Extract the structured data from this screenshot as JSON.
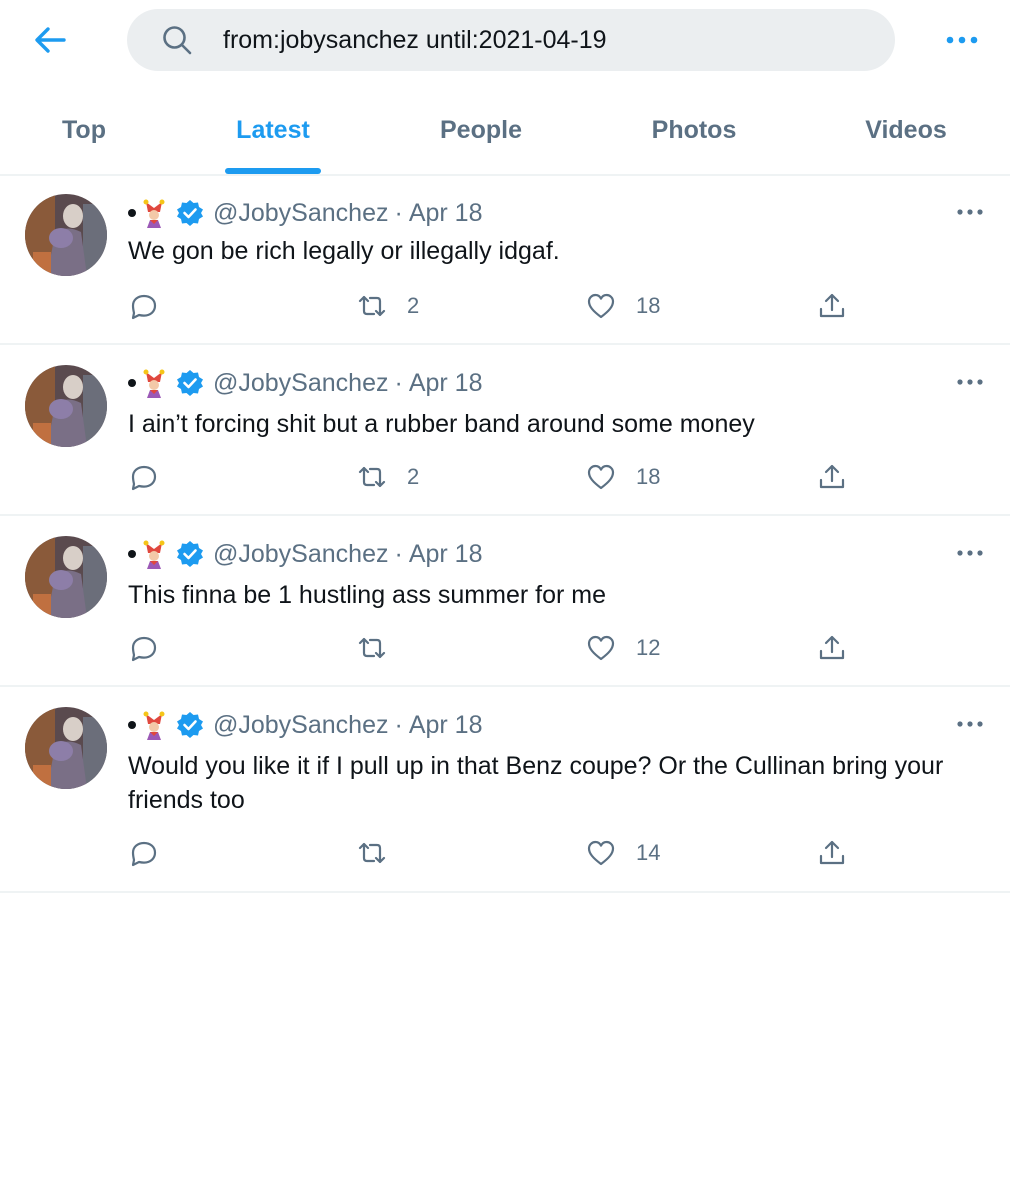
{
  "search": {
    "query": "from:jobysanchez until:2021-04-19"
  },
  "tabs": [
    {
      "label": "Top"
    },
    {
      "label": "Latest"
    },
    {
      "label": "People"
    },
    {
      "label": "Photos"
    },
    {
      "label": "Videos"
    }
  ],
  "active_tab": "Latest",
  "colors": {
    "accent": "#1d9bf0",
    "secondary_text": "#5b7083",
    "search_bg": "#ebeef0"
  },
  "tweets": [
    {
      "handle": "@JobySanchez",
      "date": "Apr 18",
      "text": "We gon be rich legally or illegally idgaf.",
      "replies": "",
      "retweets": "2",
      "likes": "18"
    },
    {
      "handle": "@JobySanchez",
      "date": "Apr 18",
      "text": "I ain’t forcing shit but a rubber band around some money",
      "replies": "",
      "retweets": "2",
      "likes": "18"
    },
    {
      "handle": "@JobySanchez",
      "date": "Apr 18",
      "text": "This finna be 1 hustling ass summer for me",
      "replies": "",
      "retweets": "",
      "likes": "12"
    },
    {
      "handle": "@JobySanchez",
      "date": "Apr 18",
      "text": "Would you like it if I pull up in that Benz coupe? Or the Cullinan bring your friends too",
      "replies": "",
      "retweets": "",
      "likes": "14"
    }
  ],
  "icons": {
    "back": "arrow-left-icon",
    "search": "search-icon",
    "more": "more-horizontal-icon",
    "reply": "reply-icon",
    "retweet": "retweet-icon",
    "like": "heart-icon",
    "share": "share-icon",
    "verified": "verified-badge-icon",
    "emoji": "jester-emoji-icon"
  }
}
